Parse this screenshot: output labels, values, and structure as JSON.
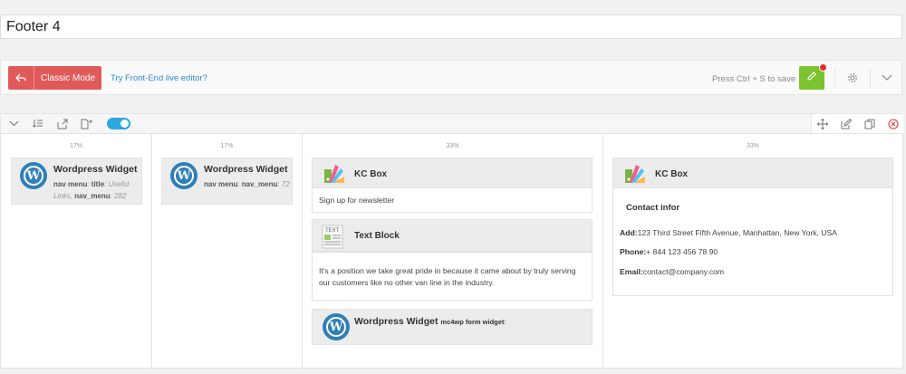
{
  "page_title": "Footer 4",
  "toolbar": {
    "classic_mode_label": "Classic Mode",
    "frontend_link": "Try Front-End live editor?",
    "save_hint": "Press Ctrl + S to save"
  },
  "columns": [
    {
      "width_label": "17%",
      "widget": {
        "title": "Wordpress Widget",
        "desc_key1": "nav menu",
        "desc_sep1": ": ",
        "desc_key2": "title",
        "desc_val2": ": Useful Links, ",
        "desc_key3": "nav_menu",
        "desc_val3": ": 282"
      }
    },
    {
      "width_label": "17%",
      "widget": {
        "title": "Wordpress Widget",
        "desc_key1": "nav menu",
        "desc_sep1": ": ",
        "desc_key2": "nav_menu",
        "desc_val2": ": 72"
      }
    },
    {
      "width_label": "33%",
      "kc_box": {
        "name": "KC Box",
        "body": "Sign up for newsletter"
      },
      "text_block": {
        "name": "Text Block",
        "icon_text": "TEXT",
        "body": "It's a position we take great pride in because it came about  by truly serving our customers like no other van line in the industry."
      },
      "widget": {
        "title": "Wordpress Widget",
        "subtitle": "mc4wp form widget",
        "subtitle_suffix": ":"
      }
    },
    {
      "width_label": "33%",
      "kc_box": {
        "name": "KC Box",
        "heading": "Contact infor",
        "address_label": "Add:",
        "address": "123 Third Street Fifth Avenue, Manhattan, New York, USA",
        "phone_label": "Phone:",
        "phone": "+ 844 123 456 78 90",
        "email_label": "Email:",
        "email": "contact@company.com"
      }
    }
  ],
  "colors": {
    "classic_btn": "#e15a5a",
    "save_btn": "#7cc42f",
    "link": "#2a8ccf",
    "toggle": "#2ba7e0",
    "wp_logo": "#2f7fb8"
  }
}
